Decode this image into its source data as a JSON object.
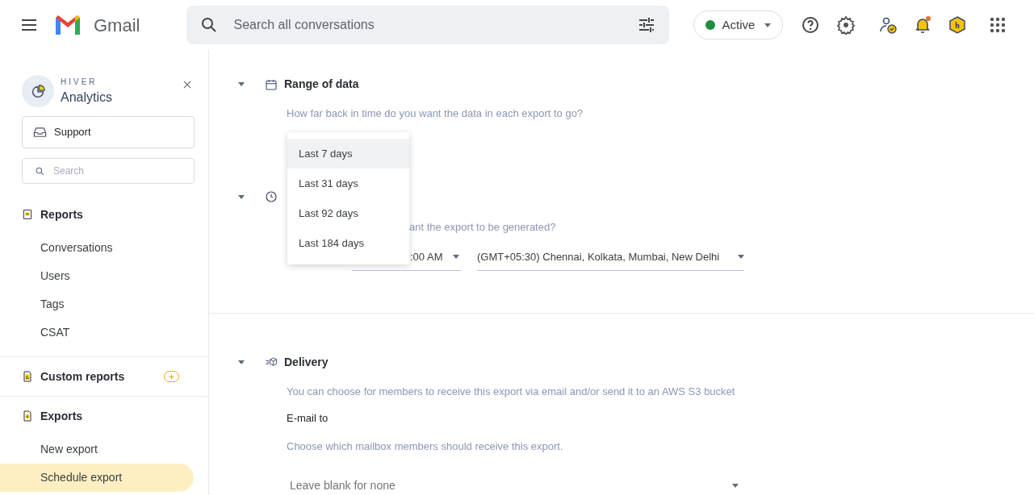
{
  "header": {
    "app_name": "Gmail",
    "search": {
      "placeholder": "Search all conversations"
    },
    "status": {
      "label": "Active",
      "color": "#1e8e3e"
    },
    "notification": true
  },
  "sidebar": {
    "brand": {
      "overline": "HIVER",
      "title": "Analytics"
    },
    "mailbox": "Support",
    "search": {
      "placeholder": "Search"
    },
    "sections": [
      {
        "kind": "reports",
        "title": "Reports",
        "items": [
          {
            "label": "Conversations",
            "selected": false
          },
          {
            "label": "Users",
            "selected": false
          },
          {
            "label": "Tags",
            "selected": false
          },
          {
            "label": "CSAT",
            "selected": false
          }
        ]
      },
      {
        "kind": "custom",
        "title": "Custom reports",
        "add": true
      },
      {
        "kind": "exports",
        "title": "Exports",
        "items": [
          {
            "label": "New export",
            "selected": false
          },
          {
            "label": "Schedule export",
            "selected": true
          }
        ]
      }
    ]
  },
  "main": {
    "range": {
      "title": "Range of data",
      "description": "How far back in time do you want the data in each export to go?",
      "options": [
        {
          "label": "Last 7 days",
          "selected": true
        },
        {
          "label": "Last 31 days",
          "selected": false
        },
        {
          "label": "Last 92 days",
          "selected": false
        },
        {
          "label": "Last 184 days",
          "selected": false
        }
      ]
    },
    "schedule": {
      "description": "ant the export to be generated?",
      "time": ":00 AM",
      "timezone": "(GMT+05:30) Chennai, Kolkata, Mumbai, New Delhi"
    },
    "delivery": {
      "title": "Delivery",
      "description": "You can choose for members to receive this export via email and/or send it to an AWS S3 bucket",
      "email_label": "E-mail to",
      "email_hint": "Choose which mailbox members should receive this export.",
      "email_placeholder": "Leave blank for none"
    }
  }
}
